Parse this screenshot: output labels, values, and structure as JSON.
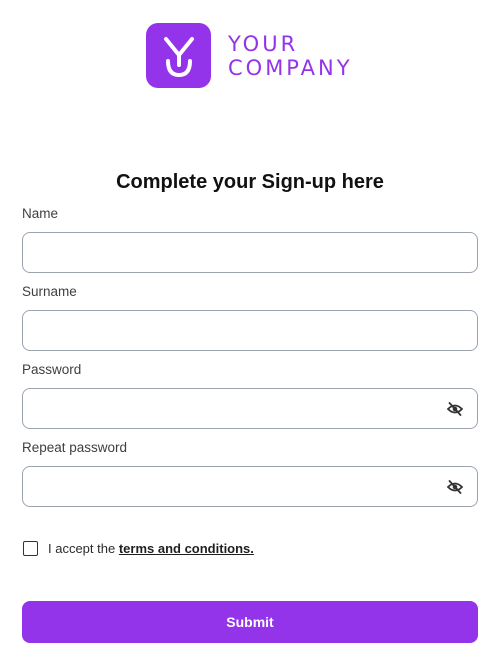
{
  "brand": {
    "line1": "YOUR",
    "line2": "COMPANY",
    "color": "#9333ea",
    "icon": "logo-y-mark-icon"
  },
  "form": {
    "title": "Complete your Sign-up here",
    "fields": [
      {
        "label": "Name",
        "value": "",
        "placeholder": ""
      },
      {
        "label": "Surname",
        "value": "",
        "placeholder": ""
      },
      {
        "label": "Password",
        "value": "",
        "placeholder": "",
        "icon": "eye-off-icon"
      },
      {
        "label": "Repeat password",
        "value": "",
        "placeholder": "",
        "icon": "eye-off-icon"
      }
    ],
    "terms": {
      "prefix": "I accept the ",
      "link": "terms and conditions.",
      "checked": false
    },
    "submit_label": "Submit"
  }
}
